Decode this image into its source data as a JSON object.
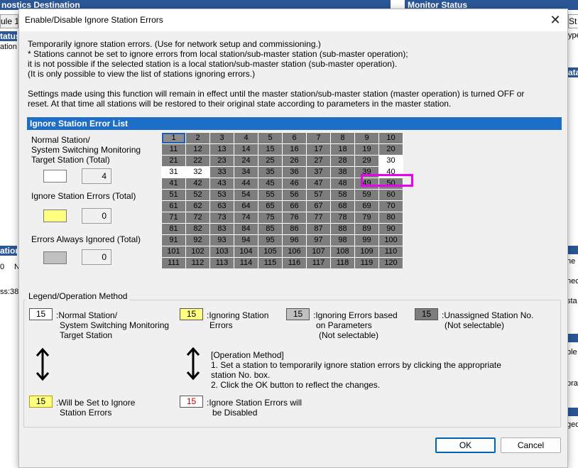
{
  "background": {
    "top_left_title": "nostics Destination",
    "top_right_title": "Monitor Status",
    "module_tab": "ule 1",
    "status_label": "tatus",
    "stations_label": "ations",
    "right_s_label": "St",
    "right_type_label": "ype",
    "right_data_label": "ata",
    "left_station_label": "ation",
    "left_zero": "0",
    "left_n": "N",
    "left_ss": "ss:38-",
    "right_he": "he",
    "right_nec": "nec",
    "right_sta": "sta",
    "right_ble": "ble",
    "right_pra": "pra",
    "right_ged": "ged"
  },
  "dialog": {
    "title": "Enable/Disable Ignore Station Errors",
    "close_glyph": "✕",
    "intro_lines": [
      "Temporarily ignore station errors. (Use for network setup and commissioning.)",
      "* Stations cannot be set to ignore errors from local station/sub-master station (sub-master operation);",
      "it is not possible if the selected station is a local station/sub-master station (sub-master operation).",
      "(It is only possible to view the list of stations ignoring errors.)"
    ],
    "settings_lines": [
      "Settings made using this function will remain in effect until the master station/sub-master station (master operation) is turned OFF or",
      "reset. At that time all stations will be restored to their original state according to parameters in the master station."
    ],
    "section_title": "Ignore Station Error List",
    "counters": {
      "normal_label_lines": [
        "Normal Station/",
        "System Switching Monitoring",
        "Target Station (Total)"
      ],
      "normal_value": "4",
      "ignore_label": "Ignore Station Errors (Total)",
      "ignore_value": "0",
      "always_label": "Errors Always Ignored (Total)",
      "always_value": "0"
    },
    "stations": [
      "1",
      "2",
      "3",
      "4",
      "5",
      "6",
      "7",
      "8",
      "9",
      "10",
      "11",
      "12",
      "13",
      "14",
      "15",
      "16",
      "17",
      "18",
      "19",
      "20",
      "21",
      "22",
      "23",
      "24",
      "25",
      "26",
      "27",
      "28",
      "29",
      "30",
      "31",
      "32",
      "33",
      "34",
      "35",
      "36",
      "37",
      "38",
      "39",
      "40",
      "41",
      "42",
      "43",
      "44",
      "45",
      "46",
      "47",
      "48",
      "49",
      "50",
      "51",
      "52",
      "53",
      "54",
      "55",
      "56",
      "57",
      "58",
      "59",
      "60",
      "61",
      "62",
      "63",
      "64",
      "65",
      "66",
      "67",
      "68",
      "69",
      "70",
      "71",
      "72",
      "73",
      "74",
      "75",
      "76",
      "77",
      "78",
      "79",
      "80",
      "81",
      "82",
      "83",
      "84",
      "85",
      "86",
      "87",
      "88",
      "89",
      "90",
      "91",
      "92",
      "93",
      "94",
      "95",
      "96",
      "97",
      "98",
      "99",
      "100",
      "101",
      "102",
      "103",
      "104",
      "105",
      "106",
      "107",
      "108",
      "109",
      "110",
      "111",
      "112",
      "113",
      "114",
      "115",
      "116",
      "117",
      "118",
      "119",
      "120"
    ],
    "normal_stations": [
      "30",
      "31",
      "32",
      "40"
    ],
    "selected_station": "1",
    "legend": {
      "title": "Legend/Operation Method",
      "sample": "15",
      "normal_lines": [
        ":Normal Station/",
        "System Switching Monitoring",
        "Target Station"
      ],
      "ignoring_lines": [
        ":Ignoring Station",
        "Errors"
      ],
      "param_lines": [
        ":Ignoring Errors based",
        "on Parameters",
        "(Not selectable)"
      ],
      "unassigned_lines": [
        ":Unassigned Station No.",
        "(Not selectable)"
      ],
      "will_set_lines": [
        ":Will be Set to Ignore",
        "Station Errors"
      ],
      "will_disable_lines": [
        ":Ignore Station Errors will",
        "be Disabled"
      ],
      "operation_lines": [
        "[Operation Method]",
        "1. Set a station to temporarily ignore station errors by clicking the appropriate",
        "station No. box.",
        "2. Click the OK button to reflect the changes."
      ]
    },
    "ok_label": "OK",
    "cancel_label": "Cancel"
  },
  "colors": {
    "normal": "#ffffff",
    "ignoring": "#ffff80",
    "param": "#c0c0c0",
    "unassigned": "#7d7d7d",
    "highlight": "#ee00ee",
    "section_header": "#1e6ec8"
  }
}
